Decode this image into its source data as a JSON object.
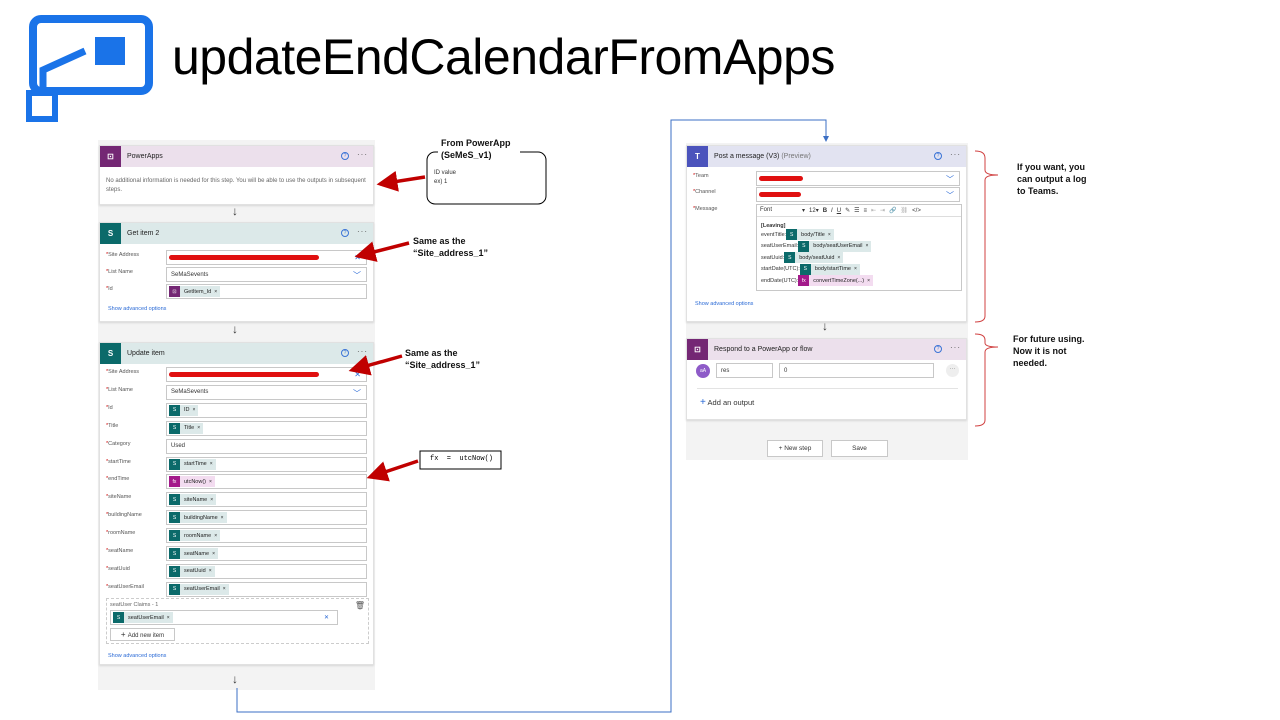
{
  "title": "updateEndCalendarFromApps",
  "colors": {
    "powerapps": "#742774",
    "sharepoint": "#0b6a6a",
    "teams": "#4b53bc",
    "expression": "#a3198a",
    "link": "#2a6ad6",
    "annotation": "#c00000"
  },
  "trigger": {
    "title": "PowerApps",
    "message": "No additional information is needed for this step. You will be able to use the outputs in subsequent steps."
  },
  "get_item": {
    "title": "Get item 2",
    "fields": [
      {
        "label": "Site Address",
        "type": "redacted"
      },
      {
        "label": "List Name",
        "value": "SeMaSevents",
        "type": "dropdown"
      },
      {
        "label": "Id",
        "token": "GetItem_Id",
        "kind": "pa"
      }
    ],
    "advanced": "Show advanced options"
  },
  "update_item": {
    "title": "Update item",
    "fields": [
      {
        "label": "Site Address",
        "type": "redacted"
      },
      {
        "label": "List Name",
        "value": "SeMaSevents",
        "type": "dropdown"
      },
      {
        "label": "Id",
        "token": "ID",
        "kind": "sp"
      },
      {
        "label": "Title",
        "token": "Title",
        "kind": "sp"
      },
      {
        "label": "Category",
        "value": "Used"
      },
      {
        "label": "startTime",
        "token": "startTime",
        "kind": "sp"
      },
      {
        "label": "endTime",
        "token": "utcNow()",
        "kind": "fx"
      },
      {
        "label": "siteName",
        "token": "siteName",
        "kind": "sp"
      },
      {
        "label": "buildingName",
        "token": "buildingName",
        "kind": "sp"
      },
      {
        "label": "roomName",
        "token": "roomName",
        "kind": "sp"
      },
      {
        "label": "seatName",
        "token": "seatName",
        "kind": "sp"
      },
      {
        "label": "seatUuid",
        "token": "seatUuid",
        "kind": "sp"
      },
      {
        "label": "seatUserEmail",
        "token": "seatUserEmail",
        "kind": "sp"
      }
    ],
    "claims_label": "seatUser Claims - 1",
    "claims_token": "seatUserEmail",
    "add_new_item": "Add new item",
    "advanced": "Show advanced options"
  },
  "post_message": {
    "title": "Post a message (V3)",
    "preview": "(Preview)",
    "team_label": "Team",
    "channel_label": "Channel",
    "message_label": "Message",
    "font": "Font",
    "font_size": "12",
    "heading": "[Leaving]",
    "lines": [
      {
        "label": "eventTitle:",
        "token": "body/Title",
        "kind": "sp"
      },
      {
        "label": "seatUserEmail:",
        "token": "body/seatUserEmail",
        "kind": "sp"
      },
      {
        "label": "seatUuid:",
        "token": "body/seatUuid",
        "kind": "sp"
      },
      {
        "label": "startDate(UTC):",
        "token": "body/startTime",
        "kind": "sp"
      },
      {
        "label": "endDate(UTC):",
        "token": "convertTimeZone(...)",
        "kind": "fx"
      }
    ],
    "advanced": "Show advanced options"
  },
  "respond": {
    "title": "Respond to a PowerApp or flow",
    "output_name": "res",
    "output_value": "0",
    "add_output": "Add an output"
  },
  "buttons": {
    "new_step": "+ New step",
    "save": "Save"
  },
  "annotations": {
    "from_powerapp": "From PowerApp (SeMeS_v1)",
    "id_value": "ID value",
    "example": "ex) 1",
    "same_as_1": "Same as the “Site_address_1”",
    "same_as_2": "Same as the “Site_address_1”",
    "fx_formula": "fx  =  utcNow()",
    "teams_note": "If you want, you can output a log to Teams.",
    "future_note": "For future using. Now it is not needed."
  }
}
